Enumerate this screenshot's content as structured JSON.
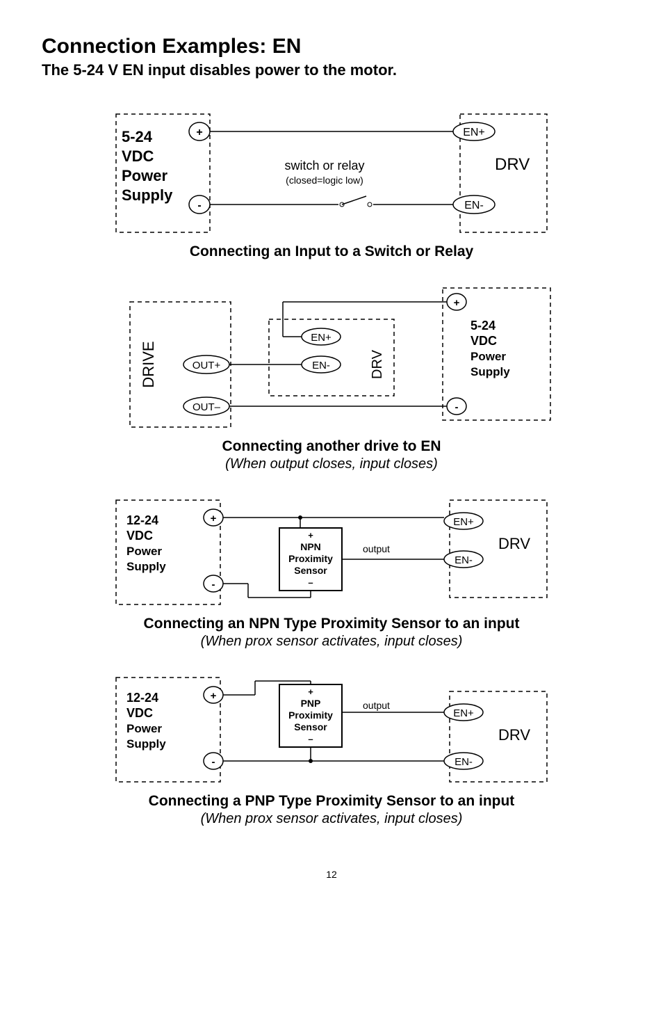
{
  "heading": "Connection Examples: EN",
  "subheading": "The 5-24 V EN input disables power to the motor.",
  "page_number": "12",
  "diagrams": {
    "d1": {
      "ps_label_l1": "5-24",
      "ps_label_l2": "VDC",
      "ps_label_l3": "Power",
      "ps_label_l4": "Supply",
      "plus": "+",
      "minus": "-",
      "switch_label_l1": "switch or relay",
      "switch_label_l2": "(closed=logic low)",
      "en_plus": "EN+",
      "en_minus": "EN-",
      "drv": "DRV",
      "caption": "Connecting an Input to a Switch or Relay"
    },
    "d2": {
      "drive_label": "DRIVE",
      "out_plus": "OUT+",
      "out_minus": "OUT–",
      "en_plus": "EN+",
      "en_minus": "EN-",
      "drv": "DRV",
      "ps_l1": "5-24",
      "ps_l2": "VDC",
      "ps_l3": "Power",
      "ps_l4": "Supply",
      "plus": "+",
      "minus": "-",
      "caption_bold": "Connecting another drive to EN",
      "caption_italic": "(When output closes, input closes)"
    },
    "d3": {
      "ps_l1": "12-24",
      "ps_l2": "VDC",
      "ps_l3": "Power",
      "ps_l4": "Supply",
      "plus": "+",
      "minus": "-",
      "sensor_plus": "+",
      "sensor_l1": "NPN",
      "sensor_l2": "Proximity",
      "sensor_l3": "Sensor",
      "sensor_minus": "–",
      "output": "output",
      "en_plus": "EN+",
      "en_minus": "EN-",
      "drv": "DRV",
      "caption_bold": "Connecting an NPN Type Proximity Sensor to an input",
      "caption_italic": "(When prox sensor activates, input closes)"
    },
    "d4": {
      "ps_l1": "12-24",
      "ps_l2": "VDC",
      "ps_l3": "Power",
      "ps_l4": "Supply",
      "plus": "+",
      "minus": "-",
      "sensor_plus": "+",
      "sensor_l1": "PNP",
      "sensor_l2": "Proximity",
      "sensor_l3": "Sensor",
      "sensor_minus": "–",
      "output": "output",
      "en_plus": "EN+",
      "en_minus": "EN-",
      "drv": "DRV",
      "caption_bold": "Connecting a PNP Type Proximity Sensor to an input",
      "caption_italic": "(When prox sensor activates, input closes)"
    }
  }
}
